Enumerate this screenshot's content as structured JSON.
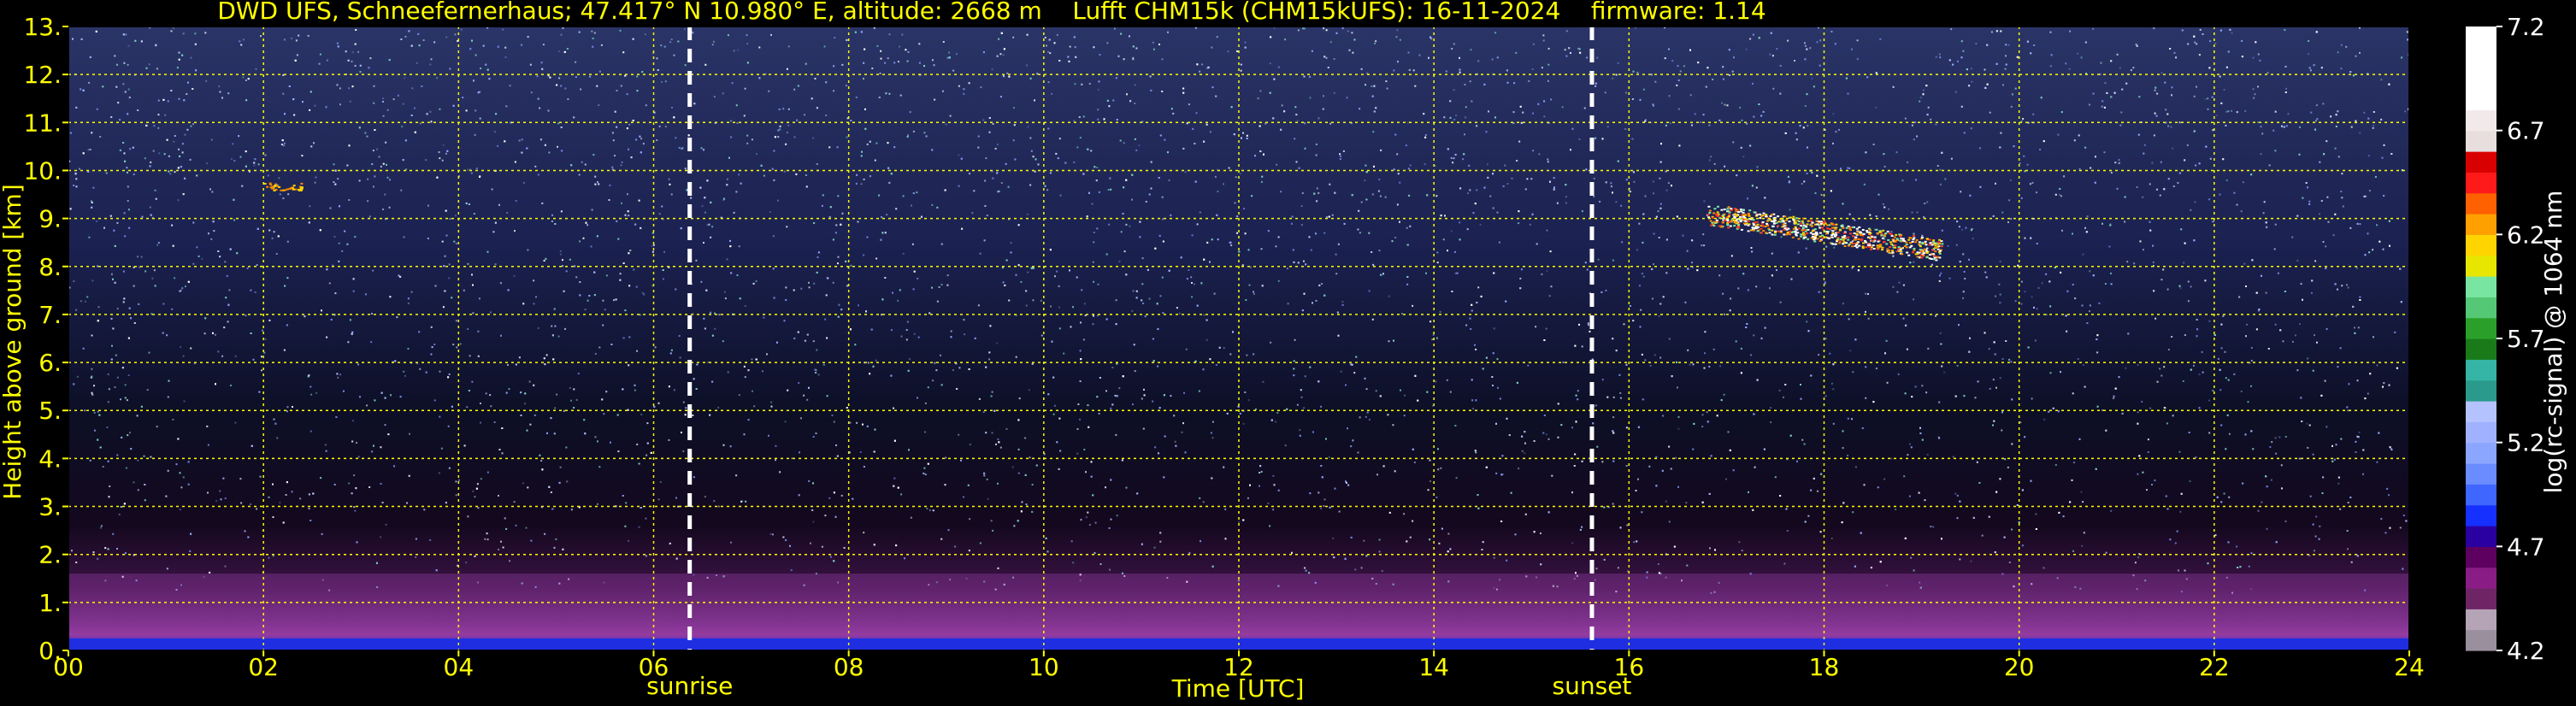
{
  "chart_data": {
    "type": "heatmap",
    "title": "DWD UFS, Schneefernerhaus; 47.417° N 10.980° E, altitude: 2668 m    Lufft CHM15k (CHM15kUFS): 16-11-2024    firmware: 1.14",
    "xlabel": "Time [UTC]",
    "ylabel": "Height above ground [km]",
    "xlim": [
      0,
      24
    ],
    "ylim": [
      0,
      13
    ],
    "x_ticks": [
      {
        "value": 0,
        "label": "00"
      },
      {
        "value": 2,
        "label": "02"
      },
      {
        "value": 4,
        "label": "04"
      },
      {
        "value": 6,
        "label": "06"
      },
      {
        "value": 8,
        "label": "08"
      },
      {
        "value": 10,
        "label": "10"
      },
      {
        "value": 12,
        "label": "12"
      },
      {
        "value": 14,
        "label": "14"
      },
      {
        "value": 16,
        "label": "16"
      },
      {
        "value": 18,
        "label": "18"
      },
      {
        "value": 20,
        "label": "20"
      },
      {
        "value": 22,
        "label": "22"
      },
      {
        "value": 24,
        "label": "24"
      }
    ],
    "y_ticks": [
      {
        "value": 0,
        "label": "0."
      },
      {
        "value": 1,
        "label": "1."
      },
      {
        "value": 2,
        "label": "2."
      },
      {
        "value": 3,
        "label": "3."
      },
      {
        "value": 4,
        "label": "4."
      },
      {
        "value": 5,
        "label": "5."
      },
      {
        "value": 6,
        "label": "6."
      },
      {
        "value": 7,
        "label": "7."
      },
      {
        "value": 8,
        "label": "8."
      },
      {
        "value": 9,
        "label": "9."
      },
      {
        "value": 10,
        "label": "10."
      },
      {
        "value": 11,
        "label": "11."
      },
      {
        "value": 12,
        "label": "12."
      },
      {
        "value": 13,
        "label": "13."
      }
    ],
    "grid": true,
    "grid_color": "#ffff00",
    "text_color": "#ffff00",
    "background_color": "#000000",
    "events": [
      {
        "label": "sunrise",
        "time": 6.37
      },
      {
        "label": "sunset",
        "time": 15.62
      }
    ],
    "colorbar": {
      "label": "log(rc-signal) @ 1064 nm",
      "range": [
        4.2,
        7.2
      ],
      "ticks": [
        "4.2",
        "4.7",
        "5.2",
        "5.7",
        "6.2",
        "6.7",
        "7.2"
      ],
      "colors": [
        "#9a8f9c",
        "#b4a4b6",
        "#6e2566",
        "#8a1c86",
        "#5e0060",
        "#2a00a0",
        "#1630ff",
        "#3f66ff",
        "#6a8cff",
        "#8aa6ff",
        "#a0b2ff",
        "#b4c2ff",
        "#2a9a8c",
        "#35b5a5",
        "#1a7a1a",
        "#2aa02a",
        "#55c875",
        "#78e6a0",
        "#e6e600",
        "#ffd400",
        "#ffa000",
        "#ff6000",
        "#ff1a1a",
        "#d80000",
        "#e8dede",
        "#f2eaea",
        "#ffffff",
        "#ffffff",
        "#ffffff",
        "#ffffff"
      ]
    },
    "features": [
      {
        "name": "boundary layer",
        "height_km": [
          0,
          1.6
        ],
        "time": [
          0,
          24
        ]
      },
      {
        "name": "surface layer",
        "height_km": [
          0,
          0.25
        ],
        "time": [
          0,
          24
        ]
      },
      {
        "name": "cirrus cloud",
        "height_km": [
          8.2,
          9.4
        ],
        "time": [
          16.8,
          19.2
        ]
      },
      {
        "name": "thin layer",
        "height_km": [
          9.6,
          9.75
        ],
        "time": [
          2.0,
          2.4
        ]
      }
    ]
  }
}
